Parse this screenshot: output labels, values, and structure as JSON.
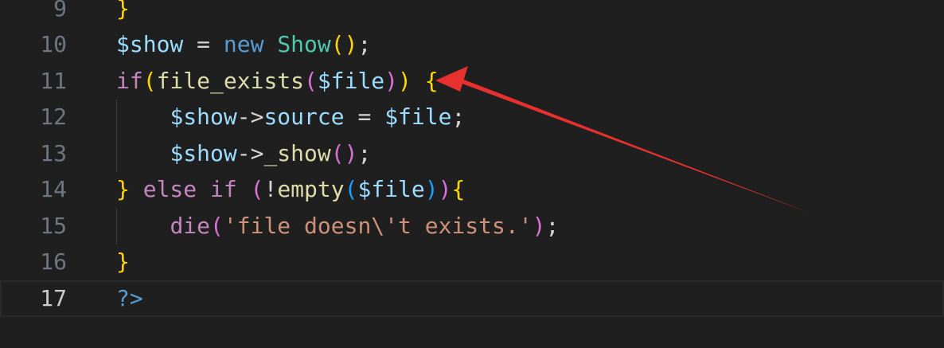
{
  "editor": {
    "lines": [
      {
        "num": "9",
        "tokens": [
          {
            "t": "}",
            "c": "br1"
          }
        ]
      },
      {
        "num": "10",
        "tokens": [
          {
            "t": "$show",
            "c": "var"
          },
          {
            "t": " = ",
            "c": "op"
          },
          {
            "t": "new",
            "c": "kw"
          },
          {
            "t": " ",
            "c": "op"
          },
          {
            "t": "Show",
            "c": "cls"
          },
          {
            "t": "(",
            "c": "br1"
          },
          {
            "t": ")",
            "c": "br1"
          },
          {
            "t": ";",
            "c": "op"
          }
        ]
      },
      {
        "num": "11",
        "tokens": [
          {
            "t": "if",
            "c": "ctl"
          },
          {
            "t": "(",
            "c": "br1"
          },
          {
            "t": "file_exists",
            "c": "fn"
          },
          {
            "t": "(",
            "c": "br2"
          },
          {
            "t": "$file",
            "c": "var"
          },
          {
            "t": ")",
            "c": "br2"
          },
          {
            "t": ")",
            "c": "br1"
          },
          {
            "t": " ",
            "c": "op"
          },
          {
            "t": "{",
            "c": "br1"
          }
        ]
      },
      {
        "num": "12",
        "tokens": [
          {
            "t": "    ",
            "c": "op"
          },
          {
            "t": "$show",
            "c": "var"
          },
          {
            "t": "->",
            "c": "op"
          },
          {
            "t": "source",
            "c": "var"
          },
          {
            "t": " = ",
            "c": "op"
          },
          {
            "t": "$file",
            "c": "var"
          },
          {
            "t": ";",
            "c": "op"
          }
        ]
      },
      {
        "num": "13",
        "tokens": [
          {
            "t": "    ",
            "c": "op"
          },
          {
            "t": "$show",
            "c": "var"
          },
          {
            "t": "->",
            "c": "op"
          },
          {
            "t": "_show",
            "c": "fn"
          },
          {
            "t": "(",
            "c": "br2"
          },
          {
            "t": ")",
            "c": "br2"
          },
          {
            "t": ";",
            "c": "op"
          }
        ]
      },
      {
        "num": "14",
        "tokens": [
          {
            "t": "}",
            "c": "br1"
          },
          {
            "t": " ",
            "c": "op"
          },
          {
            "t": "else",
            "c": "ctl"
          },
          {
            "t": " ",
            "c": "op"
          },
          {
            "t": "if",
            "c": "ctl"
          },
          {
            "t": " ",
            "c": "op"
          },
          {
            "t": "(",
            "c": "br2"
          },
          {
            "t": "!",
            "c": "op"
          },
          {
            "t": "empty",
            "c": "fn"
          },
          {
            "t": "(",
            "c": "br3"
          },
          {
            "t": "$file",
            "c": "var"
          },
          {
            "t": ")",
            "c": "br3"
          },
          {
            "t": ")",
            "c": "br2"
          },
          {
            "t": "{",
            "c": "br1"
          }
        ]
      },
      {
        "num": "15",
        "tokens": [
          {
            "t": "    ",
            "c": "op"
          },
          {
            "t": "die",
            "c": "ctl"
          },
          {
            "t": "(",
            "c": "br2"
          },
          {
            "t": "'file doesn\\'t exists.'",
            "c": "str"
          },
          {
            "t": ")",
            "c": "br2"
          },
          {
            "t": ";",
            "c": "op"
          }
        ]
      },
      {
        "num": "16",
        "tokens": [
          {
            "t": "}",
            "c": "br1"
          }
        ]
      },
      {
        "num": "17",
        "tokens": [
          {
            "t": "?>",
            "c": "tag"
          }
        ]
      }
    ],
    "current_line": "17"
  },
  "colors": {
    "background": "#1f1f1f",
    "annotation_arrow": "#e8312f"
  }
}
